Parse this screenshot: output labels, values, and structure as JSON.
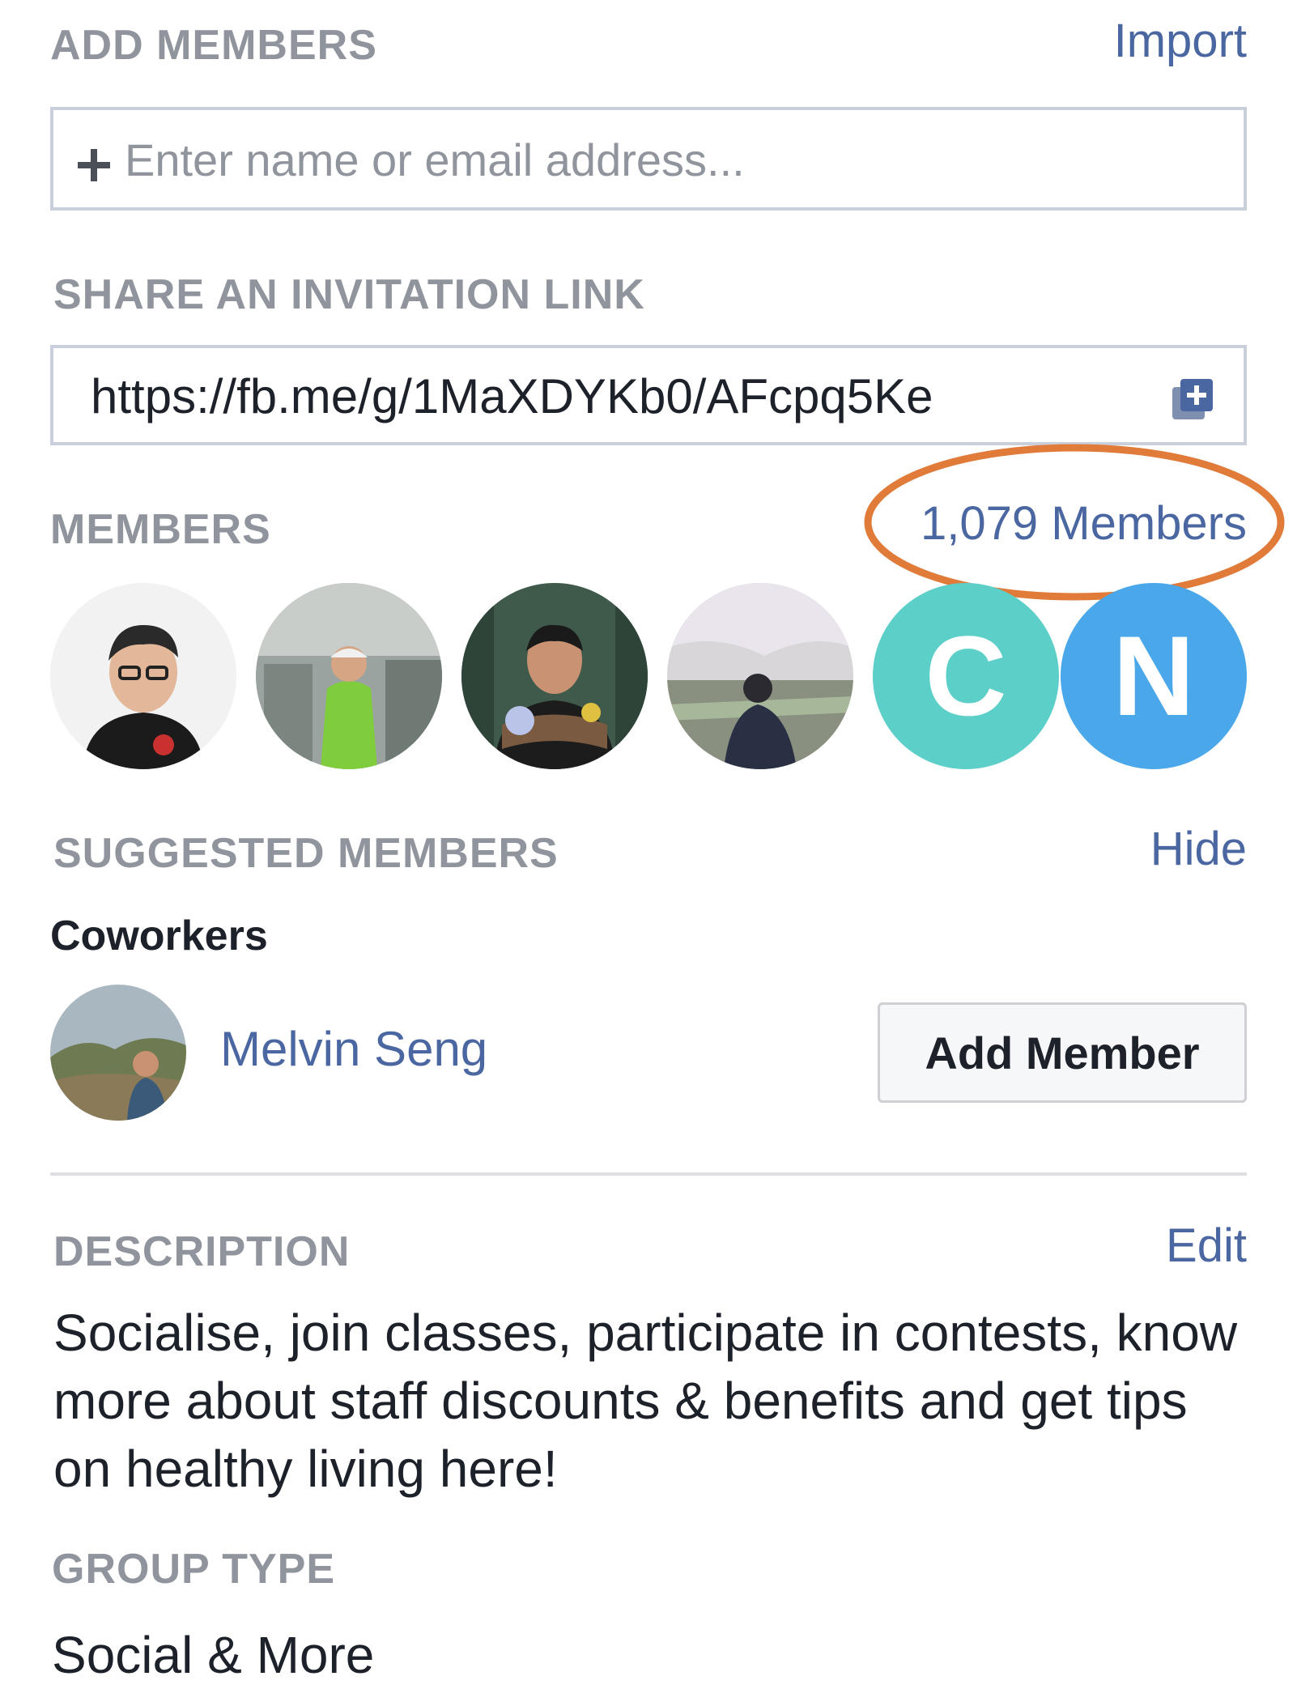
{
  "add_members": {
    "label": "ADD MEMBERS",
    "import_link": "Import",
    "input_placeholder": "Enter name or email address..."
  },
  "invitation": {
    "label": "SHARE AN INVITATION LINK",
    "url": "https://fb.me/g/1MaXDYKb0/AFcpq5Ke"
  },
  "members": {
    "label": "MEMBERS",
    "count_link": "1,079 Members",
    "highlight_color": "#e07b39",
    "avatars": [
      {
        "type": "photo"
      },
      {
        "type": "photo"
      },
      {
        "type": "photo"
      },
      {
        "type": "photo"
      },
      {
        "type": "letter",
        "letter": "C",
        "color": "#5ccfc8"
      },
      {
        "type": "letter",
        "letter": "N",
        "color": "#4aa8ea"
      }
    ]
  },
  "suggested": {
    "label": "SUGGESTED MEMBERS",
    "hide_link": "Hide",
    "group_label": "Coworkers",
    "person": {
      "name": "Melvin Seng",
      "button_label": "Add Member"
    }
  },
  "description": {
    "label": "DESCRIPTION",
    "edit_link": "Edit",
    "text": "Socialise, join classes, participate in contests, know more about staff discounts & benefits and get tips on healthy living here!"
  },
  "group_type": {
    "label": "GROUP TYPE",
    "value": "Social & More"
  }
}
